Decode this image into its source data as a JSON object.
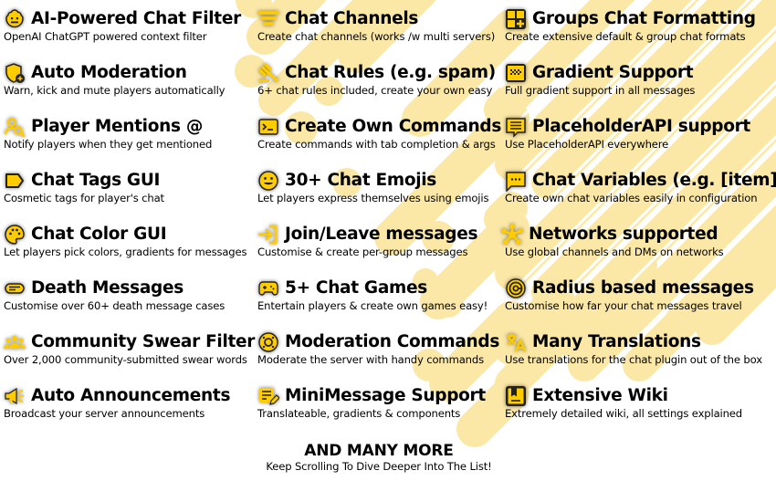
{
  "colors": {
    "accent": "#FFCC00",
    "background_stripe": "#FBE7A6",
    "text": "#000000"
  },
  "features": [
    {
      "icon": "robot-icon",
      "title": "AI-Powered Chat Filter",
      "desc": "OpenAI ChatGPT powered context filter"
    },
    {
      "icon": "shield-plus-icon",
      "title": "Auto Moderation",
      "desc": "Warn, kick and mute players automatically"
    },
    {
      "icon": "user-search-icon",
      "title": "Player Mentions @",
      "desc": "Notify players when they get mentioned"
    },
    {
      "icon": "tag-icon",
      "title": "Chat Tags GUI",
      "desc": "Cosmetic tags for player's chat"
    },
    {
      "icon": "palette-icon",
      "title": "Chat Color GUI",
      "desc": "Let players pick colors, gradients for messages"
    },
    {
      "icon": "message-bar-icon",
      "title": "Death Messages",
      "desc": "Customise over 60+ death message cases"
    },
    {
      "icon": "community-icon",
      "title": "Community Swear Filter",
      "desc": "Over 2,000 community-submitted swear words"
    },
    {
      "icon": "megaphone-icon",
      "title": "Auto Announcements",
      "desc": "Broadcast your server announcements"
    },
    {
      "icon": "filter-icon",
      "title": "Chat Channels",
      "desc": "Create chat channels (works /w multi servers)"
    },
    {
      "icon": "gavel-icon",
      "title": "Chat Rules (e.g. spam)",
      "desc": "6+ chat rules included, create your own easy"
    },
    {
      "icon": "terminal-icon",
      "title": "Create Own Commands",
      "desc": "Create commands with tab completion & args"
    },
    {
      "icon": "smiley-icon",
      "title": "30+ Chat Emojis",
      "desc": "Let players express themselves using emojis"
    },
    {
      "icon": "login-icon",
      "title": "Join/Leave messages",
      "desc": "Customise & create per-group messages"
    },
    {
      "icon": "gamepad-icon",
      "title": "5+ Chat Games",
      "desc": "Entertain players & create own games easy!"
    },
    {
      "icon": "lifebuoy-icon",
      "title": "Moderation Commands",
      "desc": "Moderate the server with handy commands"
    },
    {
      "icon": "note-edit-icon",
      "title": "MiniMessage Support",
      "desc": "Translateable, gradients & components"
    },
    {
      "icon": "grid-plus-icon",
      "title": "Groups Chat Formatting",
      "desc": "Create extensive default & group chat formats"
    },
    {
      "icon": "gradient-icon",
      "title": "Gradient Support",
      "desc": "Full gradient support in all messages"
    },
    {
      "icon": "chat-lines-icon",
      "title": "PlaceholderAPI support",
      "desc": "Use PlaceholderAPI everywhere"
    },
    {
      "icon": "chat-dots-icon",
      "title": "Chat Variables (e.g. [item])",
      "desc": "Create own chat variables easily in configuration"
    },
    {
      "icon": "network-icon",
      "title": "Networks supported",
      "desc": "Use global channels and DMs on networks"
    },
    {
      "icon": "radius-icon",
      "title": "Radius based messages",
      "desc": "Customise how far your chat messages travel"
    },
    {
      "icon": "translate-icon",
      "title": "Many Translations",
      "desc": "Use translations for the chat plugin out of the box"
    },
    {
      "icon": "book-icon",
      "title": "Extensive Wiki",
      "desc": "Extremely detailed wiki, all settings explained"
    }
  ],
  "footer": {
    "title": "AND MANY MORE",
    "subtitle": "Keep Scrolling To Dive Deeper Into The List!"
  }
}
